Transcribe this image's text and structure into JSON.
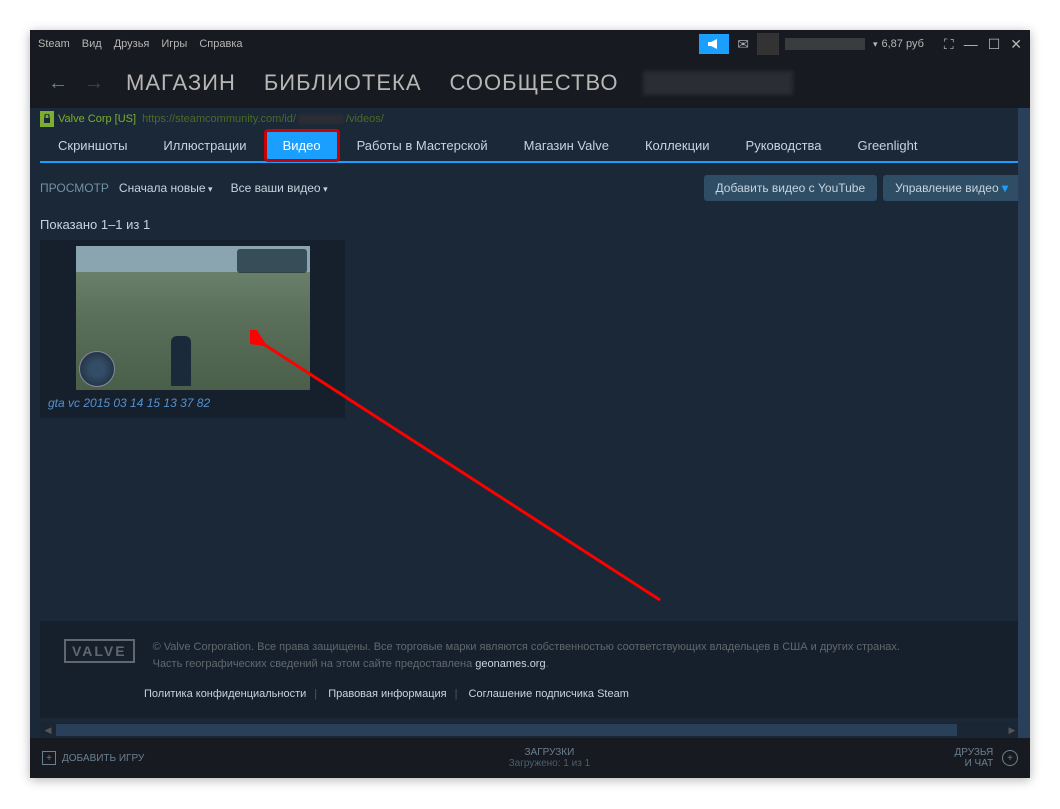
{
  "menu": {
    "steam": "Steam",
    "view": "Вид",
    "friends": "Друзья",
    "games": "Игры",
    "help": "Справка"
  },
  "header": {
    "balance": "6,87 руб"
  },
  "nav": {
    "store": "МАГАЗИН",
    "library": "БИБЛИОТЕКА",
    "community": "СООБЩЕСТВО"
  },
  "urlbar": {
    "corp": "Valve Corp [US]",
    "url1": "https://steamcommunity.com/id/",
    "url2": "/videos/"
  },
  "tabs": {
    "screenshots": "Скриншоты",
    "artwork": "Иллюстрации",
    "videos": "Видео",
    "workshop": "Работы в Мастерской",
    "merch": "Магазин Valve",
    "collections": "Коллекции",
    "guides": "Руководства",
    "greenlight": "Greenlight"
  },
  "filters": {
    "label": "ПРОСМОТР",
    "sort": "Сначала новые",
    "all": "Все ваши видео",
    "add": "Добавить видео с YouTube",
    "manage": "Управление видео"
  },
  "shown": "Показано 1–1 из 1",
  "video": {
    "title": "gta vc 2015 03 14 15 13 37 82"
  },
  "footer": {
    "copy1": "© Valve Corporation. Все права защищены. Все торговые марки являются собственностью соответствующих владельцев в США и других странах.",
    "copy2a": "Часть географических сведений на этом сайте предоставлена ",
    "copy2b": "geonames.org",
    "privacy": "Политика конфиденциальности",
    "legal": "Правовая информация",
    "ssa": "Соглашение подписчика Steam"
  },
  "bottom": {
    "add": "ДОБАВИТЬ ИГРУ",
    "downloads": "ЗАГРУЗКИ",
    "progress": "Загружено: 1 из 1",
    "friends": "ДРУЗЬЯ\nИ ЧАТ"
  }
}
